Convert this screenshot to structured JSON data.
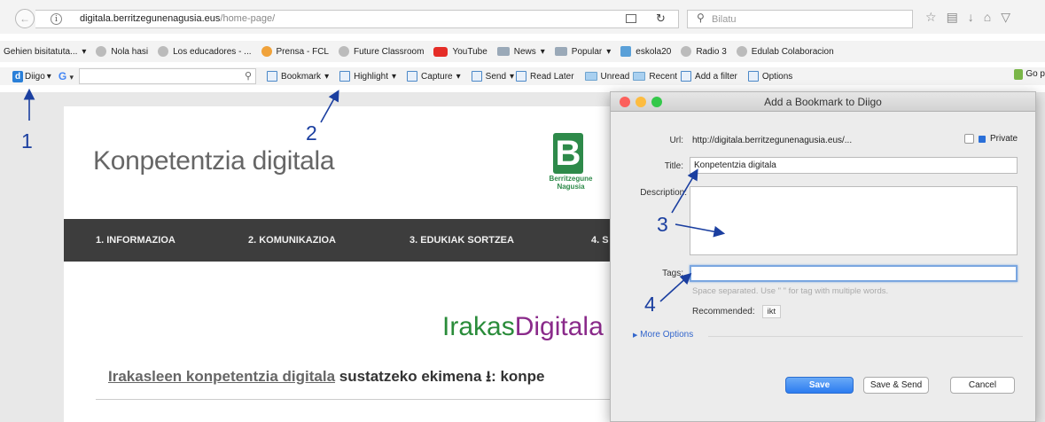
{
  "browser": {
    "url_domain": "digitala.berritzegunenagusia.eus",
    "url_path": "/home-page/",
    "search_placeholder": "Bilatu",
    "info_glyph": "i"
  },
  "bookmarks_bar": [
    {
      "label": "Gehien bisitatuta...",
      "icon": "none"
    },
    {
      "label": "Nola hasi",
      "icon": "globe-icon"
    },
    {
      "label": "Los educadores - ...",
      "icon": "globe-icon"
    },
    {
      "label": "Prensa - FCL",
      "icon": "star-icon"
    },
    {
      "label": "Future Classroom",
      "icon": "globe-icon"
    },
    {
      "label": "YouTube",
      "icon": "youtube-icon"
    },
    {
      "label": "News",
      "icon": "folder-icon"
    },
    {
      "label": "Popular",
      "icon": "folder-icon"
    },
    {
      "label": "eskola20",
      "icon": "flag-icon"
    },
    {
      "label": "Radio 3",
      "icon": "globe-icon"
    },
    {
      "label": "Edulab Colaboracion",
      "icon": "globe-icon"
    }
  ],
  "diigo_toolbar": {
    "logo_letter": "d",
    "logo_label": "Diigo",
    "google_letter": "G",
    "bookmark": "Bookmark",
    "highlight": "Highlight",
    "capture": "Capture",
    "send": "Send",
    "read_later": "Read Later",
    "unread": "Unread",
    "recent": "Recent",
    "add_filter": "Add a filter",
    "options": "Options",
    "go_partial": "Go p"
  },
  "page": {
    "site_title": "Konpetentzia digitala",
    "logo_letter": "B",
    "logo_line1": "Berritzegune",
    "logo_line2": "Nagusia",
    "nav": [
      "1. INFORMAZIOA",
      "2. KOMUNIKAZIOA",
      "3. EDUKIAK SORTZEA",
      "4. S"
    ],
    "hero_part1": "Irakas",
    "hero_part2": "Digitala",
    "intro_link": "Irakasleen konpetentzia digitala",
    "intro_rest": "sustatzeko ekimena ⭳: konpe"
  },
  "dialog": {
    "title": "Add a Bookmark to Diigo",
    "url_label": "Url:",
    "url_value": "http://digitala.berritzegunenagusia.eus/...",
    "private_label": "Private",
    "title_label": "Title:",
    "title_value": "Konpetentzia digitala",
    "description_label": "Description:",
    "tags_label": "Tags:",
    "tags_hint": "Space separated. Use \" \" for tag with multiple words.",
    "recommended_label": "Recommended:",
    "recommended_tag": "ikt",
    "more_options": "More Options",
    "save": "Save",
    "save_send": "Save & Send",
    "cancel": "Cancel"
  },
  "annotations": [
    "1",
    "2",
    "3",
    "4"
  ]
}
